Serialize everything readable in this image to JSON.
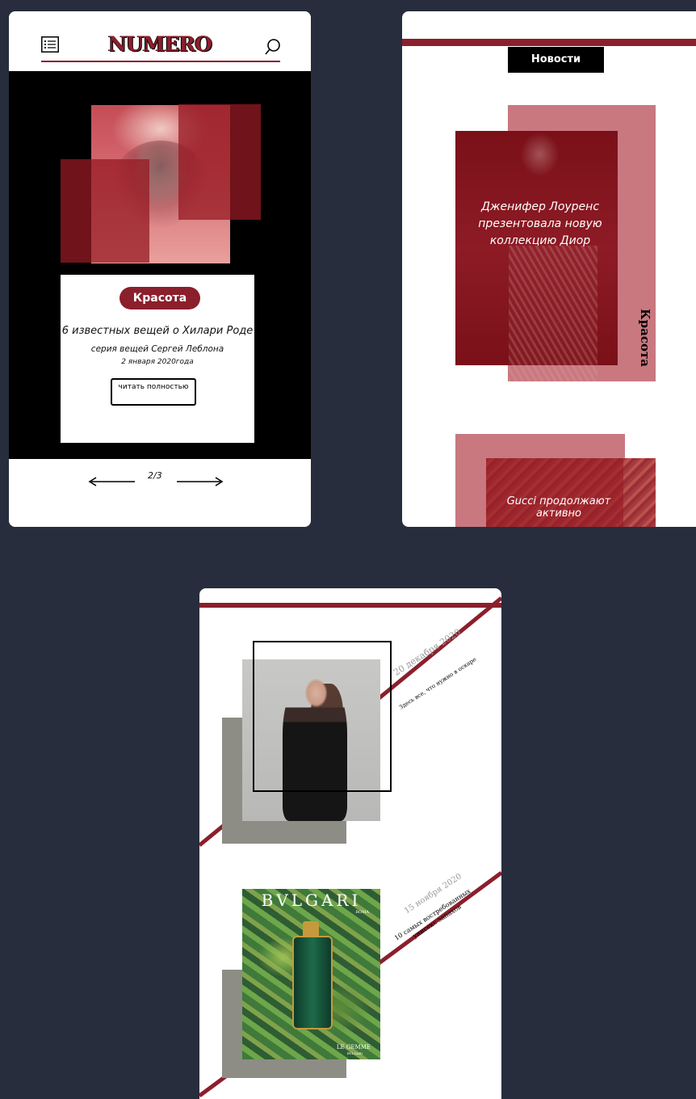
{
  "screen1": {
    "logo": "NUMERO",
    "icons": {
      "menu": "list-menu-icon",
      "search": "search-icon"
    },
    "article": {
      "tag": "Красота",
      "title": "6 известных вещей о Хилари Роде",
      "subtitle": "серия вещей Сергей Леблона",
      "date": "2 января 2020года",
      "read_button": "читать полностью"
    },
    "pager": {
      "current": "2/3",
      "prev_icon": "arrow-left-icon",
      "next_icon": "arrow-right-icon"
    }
  },
  "screen2": {
    "section_title": "Новости",
    "article1": {
      "title": "Дженифер Лоуренс презентовала новую коллекцию Диор",
      "category": "Красота"
    },
    "article2": {
      "title": "Gucci продолжают активно"
    }
  },
  "screen3": {
    "item1": {
      "date": "20 декабря 2020",
      "description": "Здесь все, что нужно в оскаре"
    },
    "item2": {
      "date": "15 ноября 2020",
      "description_line1": "10 самых востребованных",
      "description_line2": "унисекс запахов",
      "brand": "BVLGARI",
      "brand_sub": "ROMA",
      "product": "LE GEMME",
      "product_sub": "BVLGARI"
    }
  },
  "colors": {
    "accent": "#8b1f2c",
    "background": "#272d3d",
    "pink": "#c97880"
  }
}
